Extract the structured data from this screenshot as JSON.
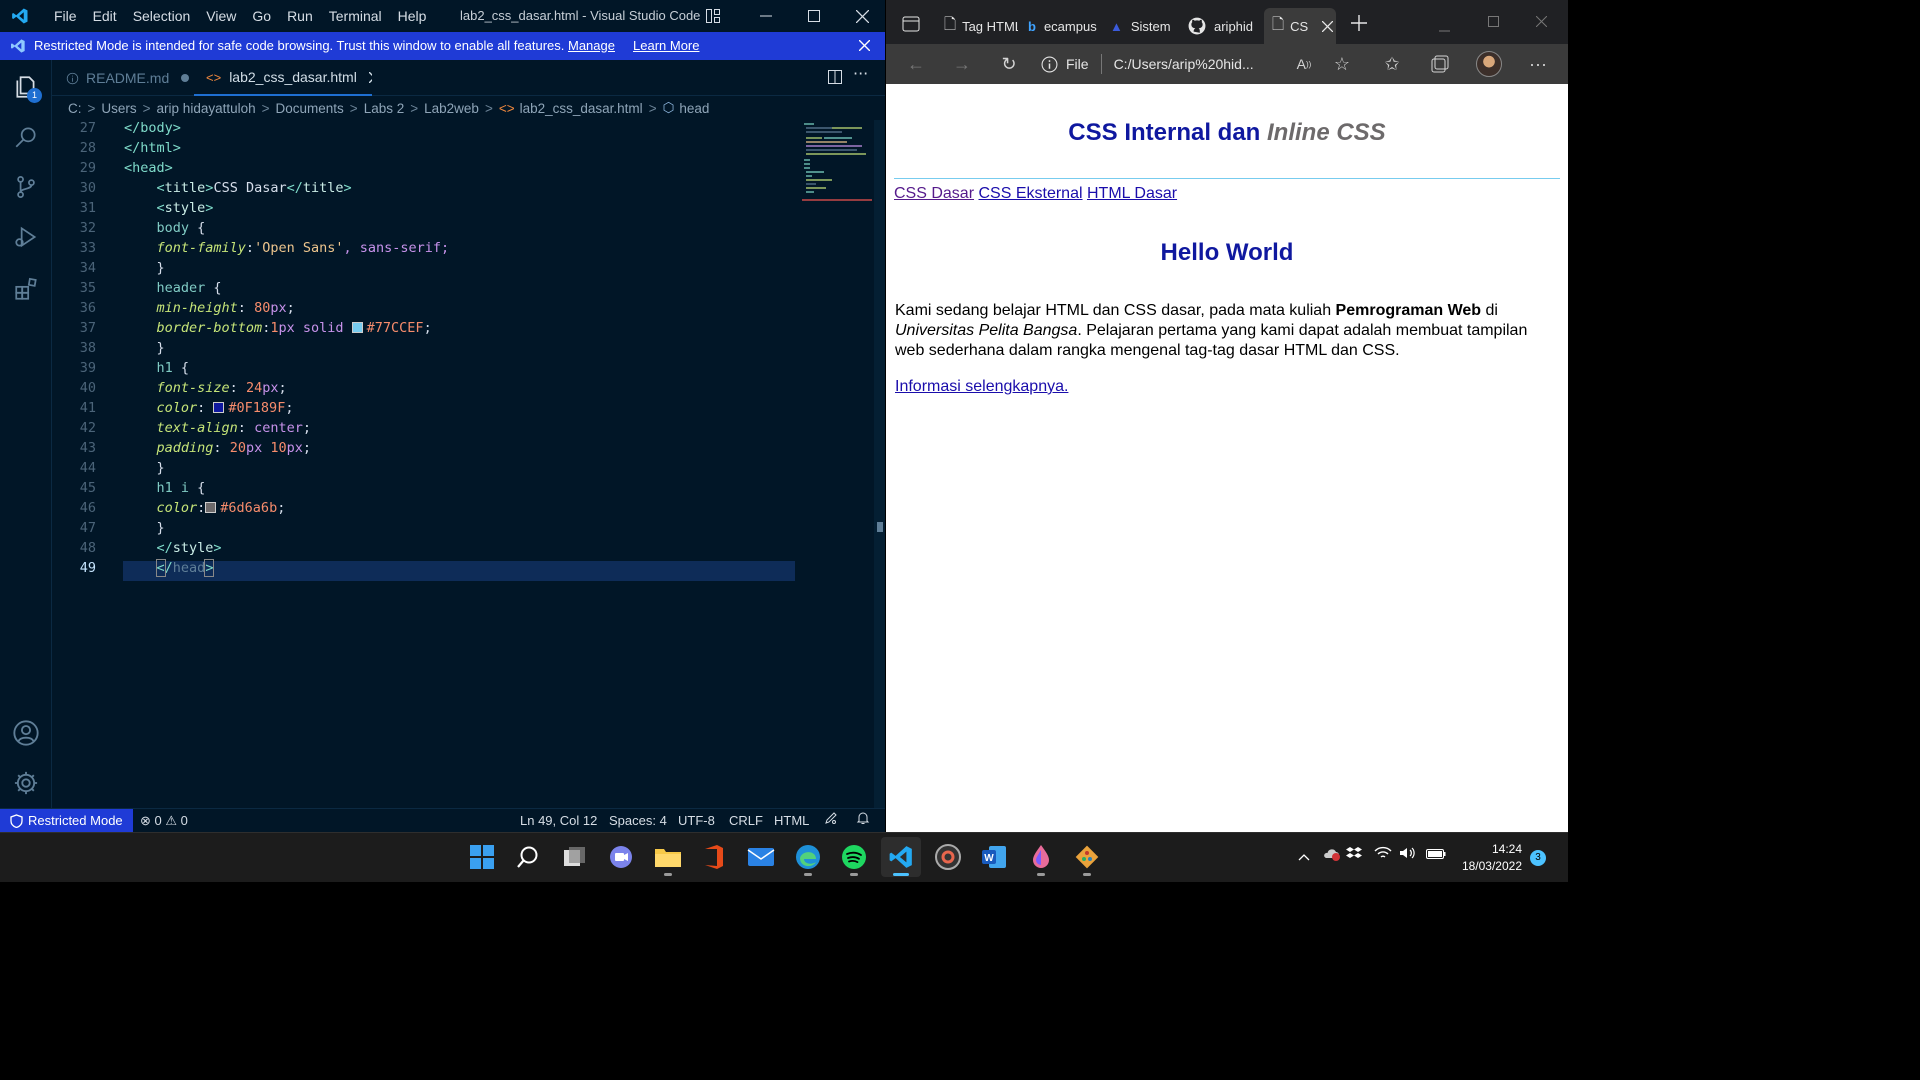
{
  "vscode": {
    "menu": [
      "File",
      "Edit",
      "Selection",
      "View",
      "Go",
      "Run",
      "Terminal",
      "Help"
    ],
    "window_title": "lab2_css_dasar.html - Visual Studio Code",
    "banner": {
      "text": "Restricted Mode is intended for safe code browsing. Trust this window to enable all features.",
      "manage": "Manage",
      "learn_more": "Learn More"
    },
    "explorer_badge": "1",
    "tabs": [
      {
        "label": "README.md",
        "active": false
      },
      {
        "label": "lab2_css_dasar.html",
        "active": true
      }
    ],
    "breadcrumbs": [
      "C:",
      "Users",
      "arip hidayattuloh",
      "Documents",
      "Labs 2",
      "Lab2web",
      "lab2_css_dasar.html",
      "head"
    ],
    "line_numbers": [
      "27",
      "28",
      "29",
      "30",
      "31",
      "32",
      "33",
      "34",
      "35",
      "36",
      "37",
      "38",
      "39",
      "40",
      "41",
      "42",
      "43",
      "44",
      "45",
      "46",
      "47",
      "48",
      "49"
    ],
    "current_line": "49",
    "code": {
      "l27": "</body>",
      "l28": "</html>",
      "l29": "<head>",
      "l30_tag": "title",
      "l30_text": "CSS Dasar",
      "l31": "style",
      "l32_sel": "body",
      "l33_prop": "font-family",
      "l33_str": "'Open Sans'",
      "l33_rest": ", sans-serif;",
      "l35_sel": "header",
      "l36_prop": "min-height",
      "l36_num": "80",
      "l36_unit": "px",
      "l37_prop": "border-bottom",
      "l37_num": "1",
      "l37_unit": "px",
      "l37_kw": "solid",
      "l37_hex": "#77CCEF",
      "l39_sel": "h1",
      "l40_prop": "font-size",
      "l40_num": "24",
      "l40_unit": "px",
      "l41_prop": "color",
      "l41_hex": "#0F189F",
      "l42_prop": "text-align",
      "l42_val": "center",
      "l43_prop": "padding",
      "l43_n1": "20",
      "l43_n2": "10",
      "l43_unit": "px",
      "l45_sel": "h1 i",
      "l46_prop": "color",
      "l46_hex": "#6d6a6b",
      "l48": "style",
      "l49": "head"
    },
    "status": {
      "mode": "Restricted Mode",
      "errors": "0",
      "warnings": "0",
      "position": "Ln 49, Col 12",
      "spaces": "Spaces: 4",
      "encoding": "UTF-8",
      "eol": "CRLF",
      "language": "HTML"
    },
    "colors": {
      "bg": "#011627",
      "accent": "#1f3bd6",
      "swatch_header": "#77CCEF",
      "swatch_h1": "#0F189F",
      "swatch_i": "#6d6a6b"
    }
  },
  "edge": {
    "tabs": [
      "Tag HTML",
      "ecampus",
      "Sistem",
      "ariphid",
      "CS"
    ],
    "url_scheme": "File",
    "url": "C:/Users/arip%20hid...",
    "page": {
      "h1_plain": "CSS Internal dan ",
      "h1_italic": "Inline CSS",
      "nav": [
        "CSS Dasar",
        "CSS Eksternal",
        "HTML Dasar"
      ],
      "h2": "Hello World",
      "p_start": "Kami sedang belajar HTML dan CSS dasar, pada mata kuliah ",
      "p_bold": "Pemrograman Web",
      "p_mid": " di ",
      "p_italic": "Universitas Pelita Bangsa",
      "p_end": ". Pelajaran pertama yang kami dapat adalah membuat tampilan web sederhana dalam rangka mengenal tag-tag dasar HTML dan CSS.",
      "more_link": "Informasi selengkapnya."
    }
  },
  "taskbar": {
    "apps": [
      "start-icon",
      "search-icon",
      "task-view-icon",
      "chat-icon",
      "file-explorer-icon",
      "office-icon",
      "mail-icon",
      "edge-icon",
      "spotify-icon",
      "vscode-icon",
      "media-icon",
      "word-icon",
      "paint-icon",
      "git-icon"
    ],
    "time": "14:24",
    "date": "18/03/2022",
    "notifications": "3"
  }
}
